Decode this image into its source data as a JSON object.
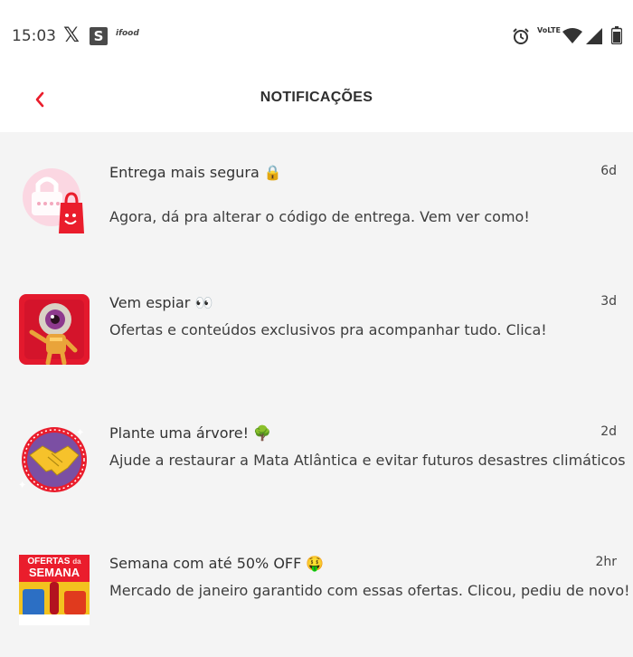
{
  "statusbar": {
    "time": "15:03",
    "volte_line1": "Vo",
    "volte_line2": "LTE",
    "ifood_label": "ifood"
  },
  "header": {
    "title": "NOTIFICAÇÕES",
    "back_icon": "chevron-left-icon"
  },
  "colors": {
    "accent": "#ea1d2c",
    "background": "#f4f4f4",
    "header_bg": "#ffffff"
  },
  "notifications": [
    {
      "title": "Entrega mais segura 🔒",
      "body": "Agora, dá pra alterar o código de entrega. Vem ver como!",
      "time": "6d",
      "icon": "lock-bag-icon"
    },
    {
      "title": "Vem espiar 👀",
      "body": "Ofertas e conteúdos exclusivos pra acompanhar tudo. Clica!",
      "time": "3d",
      "icon": "eye-mascot-icon"
    },
    {
      "title": "Plante uma árvore! 🌳",
      "body": "Ajude a restaurar a Mata Atlântica e evitar futuros desastres climáticos",
      "time": "2d",
      "icon": "handshake-badge-icon"
    },
    {
      "title": "Semana com até 50% OFF 🤑",
      "body": "Mercado de janeiro garantido com essas ofertas. Clicou, pediu de novo!",
      "time": "2hr",
      "icon": "ofertas-semana-icon",
      "thumb_line1": "OFERTAS",
      "thumb_line2": "SEMANA",
      "thumb_da": "da"
    }
  ]
}
